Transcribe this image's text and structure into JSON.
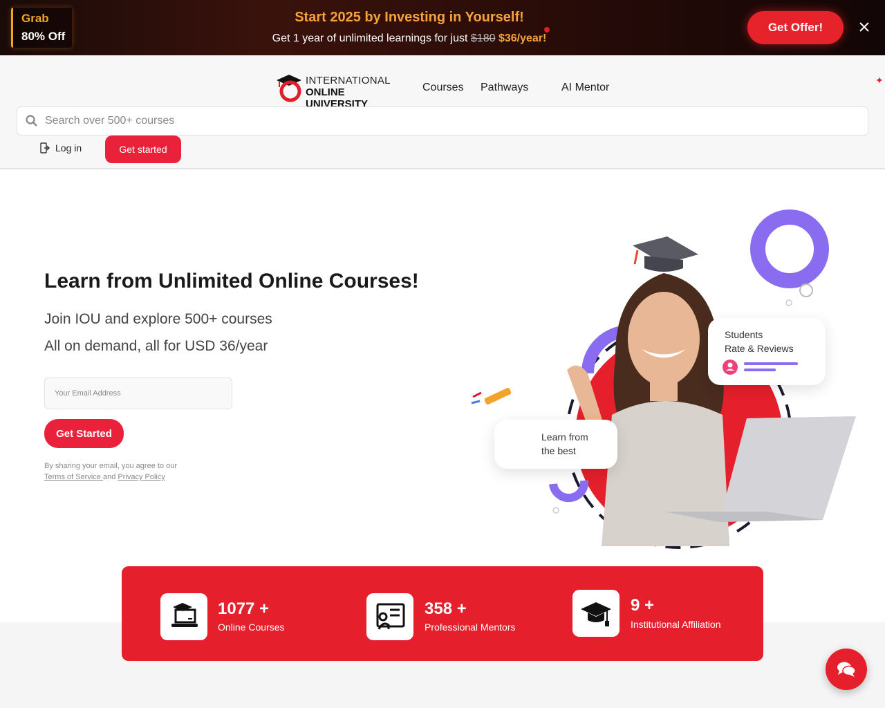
{
  "promo": {
    "grab_line1": "Grab",
    "grab_line2": "80% Off",
    "title": "Start 2025 by Investing in Yourself!",
    "sub_prefix": "Get 1 year of unlimited learnings for just",
    "old_price": "$180",
    "new_price": "$36/year!",
    "offer_button": "Get Offer!",
    "close_icon": "close-icon"
  },
  "header": {
    "logo_line1": "INTERNATIONAL",
    "logo_line2": "ONLINE UNIVERSITY",
    "nav": [
      "Courses",
      "Pathways",
      "AI Mentor"
    ],
    "search_placeholder": "Search over 500+ courses",
    "login_label": "Log in",
    "get_started_label": "Get started"
  },
  "hero": {
    "title": "Learn from Unlimited Online Courses!",
    "subtitle1": "Join IOU and explore 500+ courses",
    "subtitle2": "All on demand, all for USD 36/year",
    "email_placeholder": "Your Email Address",
    "cta_label": "Get Started",
    "legal_prefix": "By sharing your email, you agree to our",
    "terms_link": "Terms of Service ",
    "legal_and": "and",
    "privacy_link": "Privacy Policy",
    "card_reviews_line1": "Students",
    "card_reviews_line2": "Rate & Reviews",
    "card_learn_line1": "Learn from",
    "card_learn_line2": "the best"
  },
  "stats": [
    {
      "number": "1077 +",
      "label": "Online Courses",
      "icon": "laptop-graduation-icon"
    },
    {
      "number": "358 +",
      "label": "Professional Mentors",
      "icon": "mentor-board-icon"
    },
    {
      "number": "9 +",
      "label": "Institutional Affiliation",
      "icon": "graduation-cap-icon"
    }
  ],
  "colors": {
    "accent": "#e51f2b",
    "promo_orange": "#f6a23c"
  }
}
